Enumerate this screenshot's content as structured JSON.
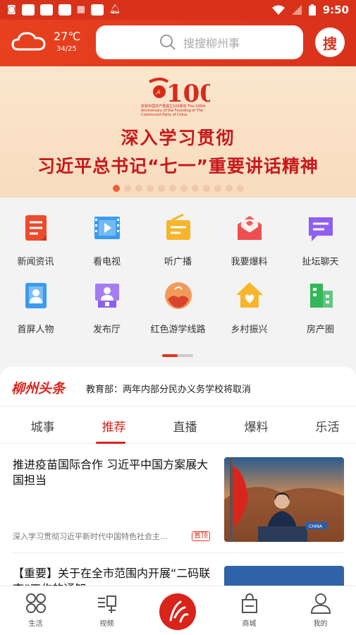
{
  "status_bar": {
    "time": "9:50"
  },
  "header": {
    "temperature": "27℃",
    "temp_range": "34/25",
    "search_placeholder": "搜搜柳州事",
    "search_button": "搜"
  },
  "banner": {
    "logo_number": "100",
    "logo_caption": "庆祝中国共产党成立100周年 The 100th Anniversary of the Founding of The Communist Party of China",
    "line1": "深入学习贯彻",
    "line2": "习近平总书记“七一”重要讲话精神",
    "slide_count": 12,
    "active_slide": 1
  },
  "grid": {
    "items": [
      {
        "label": "新闻资讯",
        "icon": "news-icon",
        "color": "#ee4a2c"
      },
      {
        "label": "看电视",
        "icon": "tv-icon",
        "color": "#3a9bf0"
      },
      {
        "label": "听广播",
        "icon": "radio-icon",
        "color": "#f7b52c"
      },
      {
        "label": "我要爆料",
        "icon": "envelope-icon",
        "color": "#f25a5a"
      },
      {
        "label": "扯坛聊天",
        "icon": "chat-icon",
        "color": "#8e5ff0"
      },
      {
        "label": "首屏人物",
        "icon": "person-card-icon",
        "color": "#3a9bf0"
      },
      {
        "label": "发布厅",
        "icon": "podium-icon",
        "color": "#8e5ff0"
      },
      {
        "label": "红色游学线路",
        "icon": "red-tour-icon",
        "color": "#d9422b"
      },
      {
        "label": "乡村振兴",
        "icon": "house-heart-icon",
        "color": "#f7b52c"
      },
      {
        "label": "房产圈",
        "icon": "building-icon",
        "color": "#33b75a"
      }
    ]
  },
  "headline": {
    "logo": "柳州头条",
    "text": "教育部：两年内部分民办义务学校将取消"
  },
  "tabs": [
    {
      "label": "城事",
      "active": false
    },
    {
      "label": "推荐",
      "active": true
    },
    {
      "label": "直播",
      "active": false
    },
    {
      "label": "爆料",
      "active": false
    },
    {
      "label": "乐活",
      "active": false
    }
  ],
  "articles": [
    {
      "title": "推进疫苗国际合作 习近平中国方案展大国担当",
      "source": "深入学习贯彻习近平新时代中国特色社会主...",
      "badge": "置顶",
      "image_caption": "CHINA"
    },
    {
      "title": "【重要】关于在全市范围内开展“二码联查”工作的通知"
    }
  ],
  "bottom_nav": [
    {
      "label": "生活",
      "icon": "grid-icon"
    },
    {
      "label": "视频",
      "icon": "video-list-icon"
    },
    {
      "label": "",
      "icon": "app-logo-icon"
    },
    {
      "label": "商城",
      "icon": "shopping-bag-icon"
    },
    {
      "label": "我的",
      "icon": "user-icon"
    }
  ]
}
